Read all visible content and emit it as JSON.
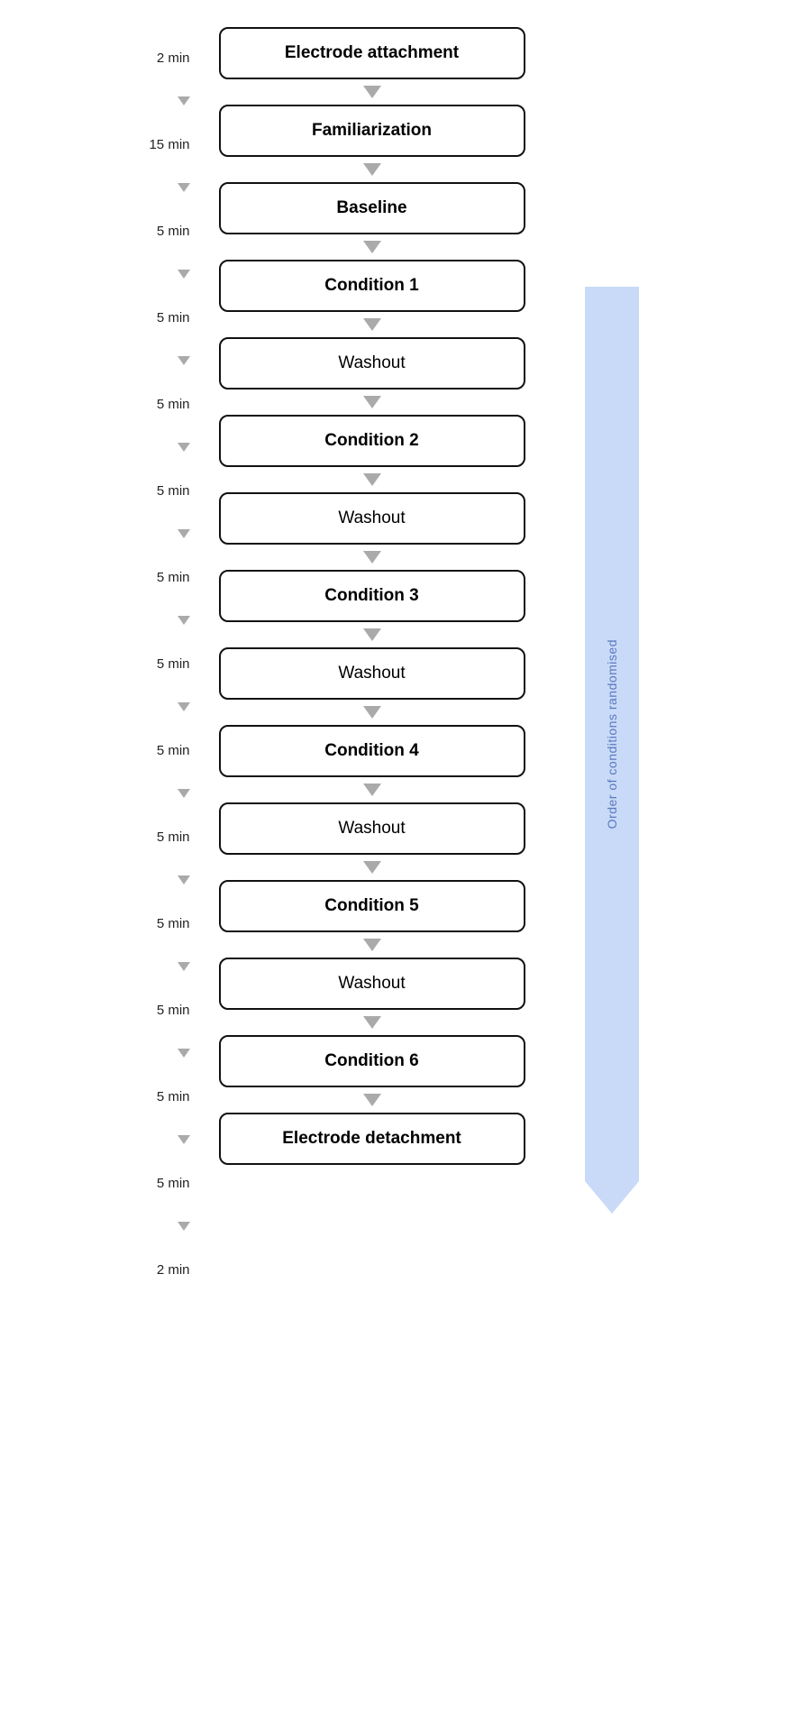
{
  "steps": [
    {
      "id": "electrode-attachment",
      "label": "Electrode attachment",
      "bold": true,
      "time": "2 min",
      "showTimeBefore": true
    },
    {
      "id": "familiarization",
      "label": "Familiarization",
      "bold": true,
      "time": "15 min",
      "showTimeBefore": true
    },
    {
      "id": "baseline",
      "label": "Baseline",
      "bold": true,
      "time": "5 min",
      "showTimeBefore": true
    },
    {
      "id": "condition-1",
      "label": "Condition 1",
      "bold": true,
      "time": "5 min",
      "showTimeBefore": true
    },
    {
      "id": "washout-1",
      "label": "Washout",
      "bold": false,
      "time": "5 min",
      "showTimeBefore": true
    },
    {
      "id": "condition-2",
      "label": "Condition 2",
      "bold": true,
      "time": "5 min",
      "showTimeBefore": true
    },
    {
      "id": "washout-2",
      "label": "Washout",
      "bold": false,
      "time": "5 min",
      "showTimeBefore": true
    },
    {
      "id": "condition-3",
      "label": "Condition 3",
      "bold": true,
      "time": "5 min",
      "showTimeBefore": true
    },
    {
      "id": "washout-3",
      "label": "Washout",
      "bold": false,
      "time": "5 min",
      "showTimeBefore": true
    },
    {
      "id": "condition-4",
      "label": "Condition 4",
      "bold": true,
      "time": "5 min",
      "showTimeBefore": true
    },
    {
      "id": "washout-4",
      "label": "Washout",
      "bold": false,
      "time": "5 min",
      "showTimeBefore": true
    },
    {
      "id": "condition-5",
      "label": "Condition 5",
      "bold": true,
      "time": "5 min",
      "showTimeBefore": true
    },
    {
      "id": "washout-5",
      "label": "Washout",
      "bold": false,
      "time": "5 min",
      "showTimeBefore": true
    },
    {
      "id": "condition-6",
      "label": "Condition 6",
      "bold": true,
      "time": "5 min",
      "showTimeBefore": true
    },
    {
      "id": "electrode-detachment",
      "label": "Electrode detachment",
      "bold": true,
      "time": "2 min",
      "showTimeBefore": true
    }
  ],
  "side_annotation": {
    "text": "Order of conditions randomised",
    "color": "#c9daf8",
    "text_color": "#5a7abf"
  }
}
